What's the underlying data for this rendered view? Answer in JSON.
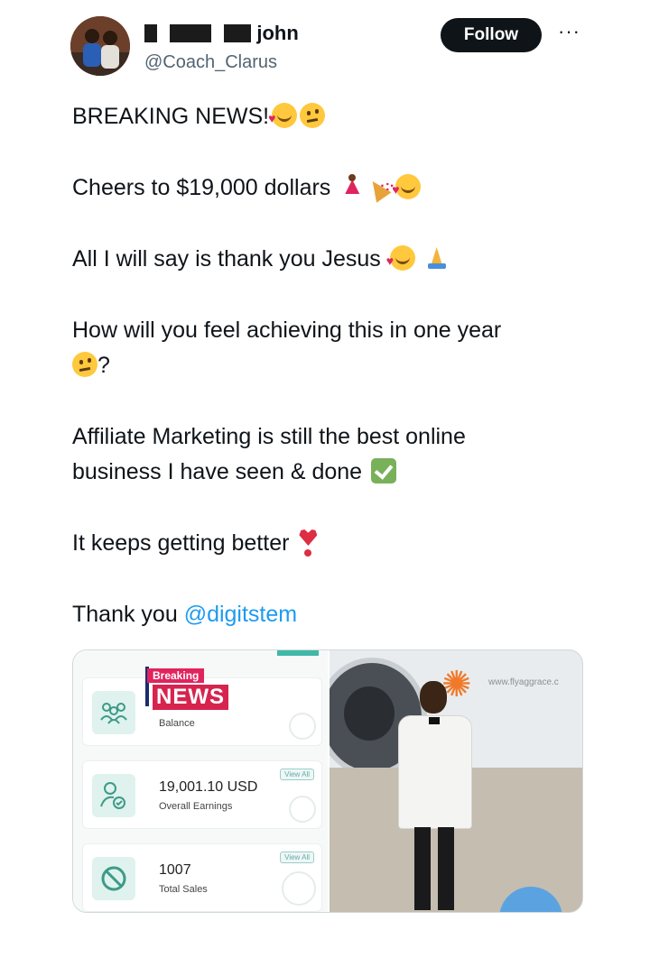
{
  "header": {
    "display_name_visible": "john",
    "handle": "@Coach_Clarus",
    "follow_label": "Follow",
    "more_label": "···"
  },
  "tweet": {
    "line1": "BREAKING NEWS!",
    "line2": "Cheers to $19,000 dollars",
    "line3": "All I will say is thank you Jesus",
    "line4a": "How will you feel achieving this in one year",
    "line4b": "?",
    "line5a": "Affiliate Marketing is still the best online",
    "line5b": "business I have seen & done",
    "line6": "It keeps getting better",
    "line7_prefix": "Thank you ",
    "line7_mention": "@digitstem"
  },
  "media": {
    "breaking": "Breaking",
    "news": "NEWS",
    "card1_label": "Balance",
    "card2_value": "19,001.10 USD",
    "card2_label": "Overall Earnings",
    "card2_view": "View All",
    "card3_value": "1007",
    "card3_label": "Total Sales",
    "card3_view": "View All",
    "photo_url_text": "www.flyaggrace.c"
  },
  "icons": {
    "avatar": "profile-photo",
    "emoji_smile_hearts": "smiling-face-with-hearts-emoji",
    "emoji_think": "thinking-face-emoji",
    "emoji_dancer": "woman-dancing-emoji",
    "emoji_party": "party-popper-emoji",
    "emoji_pray": "folded-hands-emoji",
    "emoji_check": "check-mark-button-emoji",
    "emoji_heart": "heart-exclamation-emoji"
  },
  "colors": {
    "link": "#1d9bf0",
    "follow_bg": "#0f1419",
    "accent_teal": "#3fb8a7",
    "news_red": "#d6244f"
  }
}
